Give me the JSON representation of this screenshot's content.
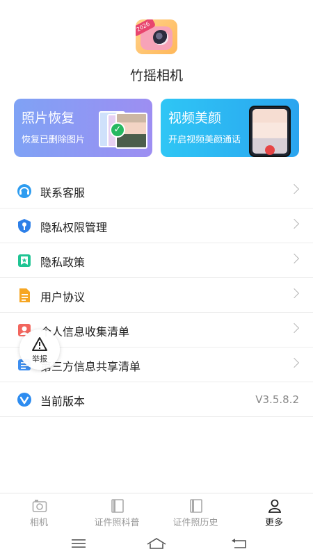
{
  "app": {
    "name": "竹摇相机",
    "logo_badge": "2026"
  },
  "promos": [
    {
      "title": "照片恢复",
      "subtitle": "恢复已删除图片",
      "color": "#8a9cf4"
    },
    {
      "title": "视频美颜",
      "subtitle": "开启视频美颜通话",
      "color": "#2db8f3"
    }
  ],
  "menu": {
    "items": [
      {
        "label": "联系客服",
        "icon": "headset-icon"
      },
      {
        "label": "隐私权限管理",
        "icon": "shield-key-icon"
      },
      {
        "label": "隐私政策",
        "icon": "bookmark-star-icon"
      },
      {
        "label": "用户协议",
        "icon": "document-icon"
      },
      {
        "label": "个人信息收集清单",
        "icon": "person-card-icon"
      },
      {
        "label": "第三方信息共享清单",
        "icon": "list-icon"
      },
      {
        "label": "当前版本",
        "icon": "version-icon",
        "value": "V3.5.8.2"
      }
    ]
  },
  "report": {
    "label": "举报"
  },
  "tabs": [
    {
      "label": "相机",
      "icon": "camera-icon",
      "active": false
    },
    {
      "label": "证件照科普",
      "icon": "book-icon",
      "active": false
    },
    {
      "label": "证件照历史",
      "icon": "book-icon",
      "active": false
    },
    {
      "label": "更多",
      "icon": "person-icon",
      "active": true
    }
  ]
}
